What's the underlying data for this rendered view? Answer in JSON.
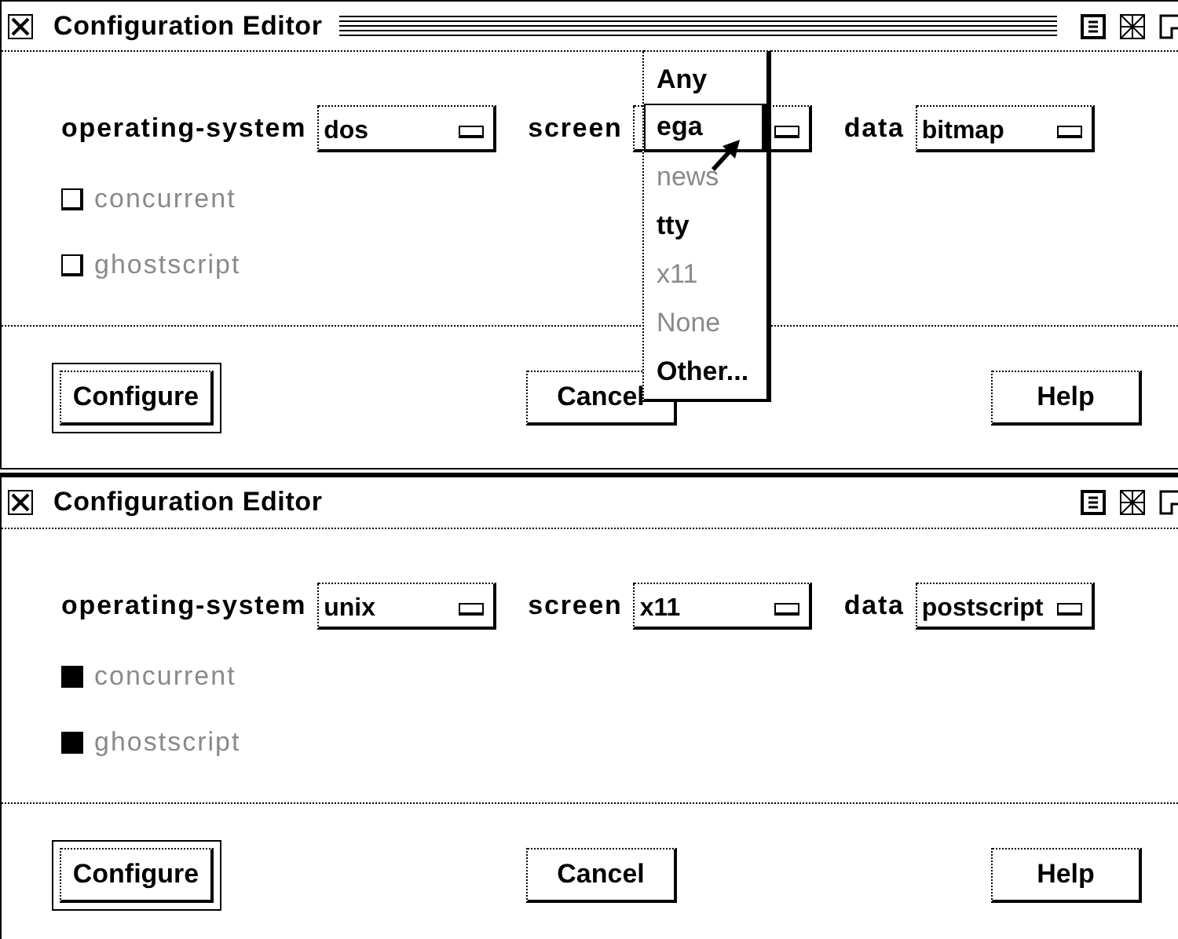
{
  "windows": [
    {
      "title": "Configuration Editor",
      "active": true,
      "fields": [
        {
          "label": "operating-system",
          "value": "dos"
        },
        {
          "label": "screen"
        },
        {
          "label": "data",
          "value": "bitmap"
        }
      ],
      "options": [
        {
          "label": "concurrent",
          "checked": false,
          "disabled": true
        },
        {
          "label": "ghostscript",
          "checked": false,
          "disabled": true
        }
      ],
      "buttons": [
        {
          "label": "Configure",
          "default": true
        },
        {
          "label": "Cancel",
          "default": false
        },
        {
          "label": "Help",
          "default": false
        }
      ],
      "menu": {
        "items": [
          {
            "label": "Any",
            "selected": false,
            "disabled": false
          },
          {
            "label": "ega",
            "selected": true,
            "disabled": false
          },
          {
            "label": "news",
            "selected": false,
            "disabled": true
          },
          {
            "label": "tty",
            "selected": false,
            "disabled": false
          },
          {
            "label": "x11",
            "selected": false,
            "disabled": true
          },
          {
            "label": "None",
            "selected": false,
            "disabled": true
          },
          {
            "label": "Other...",
            "selected": false,
            "disabled": false
          }
        ]
      }
    },
    {
      "title": "Configuration Editor",
      "active": false,
      "fields": [
        {
          "label": "operating-system",
          "value": "unix"
        },
        {
          "label": "screen",
          "value": "x11"
        },
        {
          "label": "data",
          "value": "postscript"
        }
      ],
      "options": [
        {
          "label": "concurrent",
          "checked": true,
          "disabled": true
        },
        {
          "label": "ghostscript",
          "checked": true,
          "disabled": true
        }
      ],
      "buttons": [
        {
          "label": "Configure",
          "default": true
        },
        {
          "label": "Cancel",
          "default": false
        },
        {
          "label": "Help",
          "default": false
        }
      ]
    }
  ]
}
